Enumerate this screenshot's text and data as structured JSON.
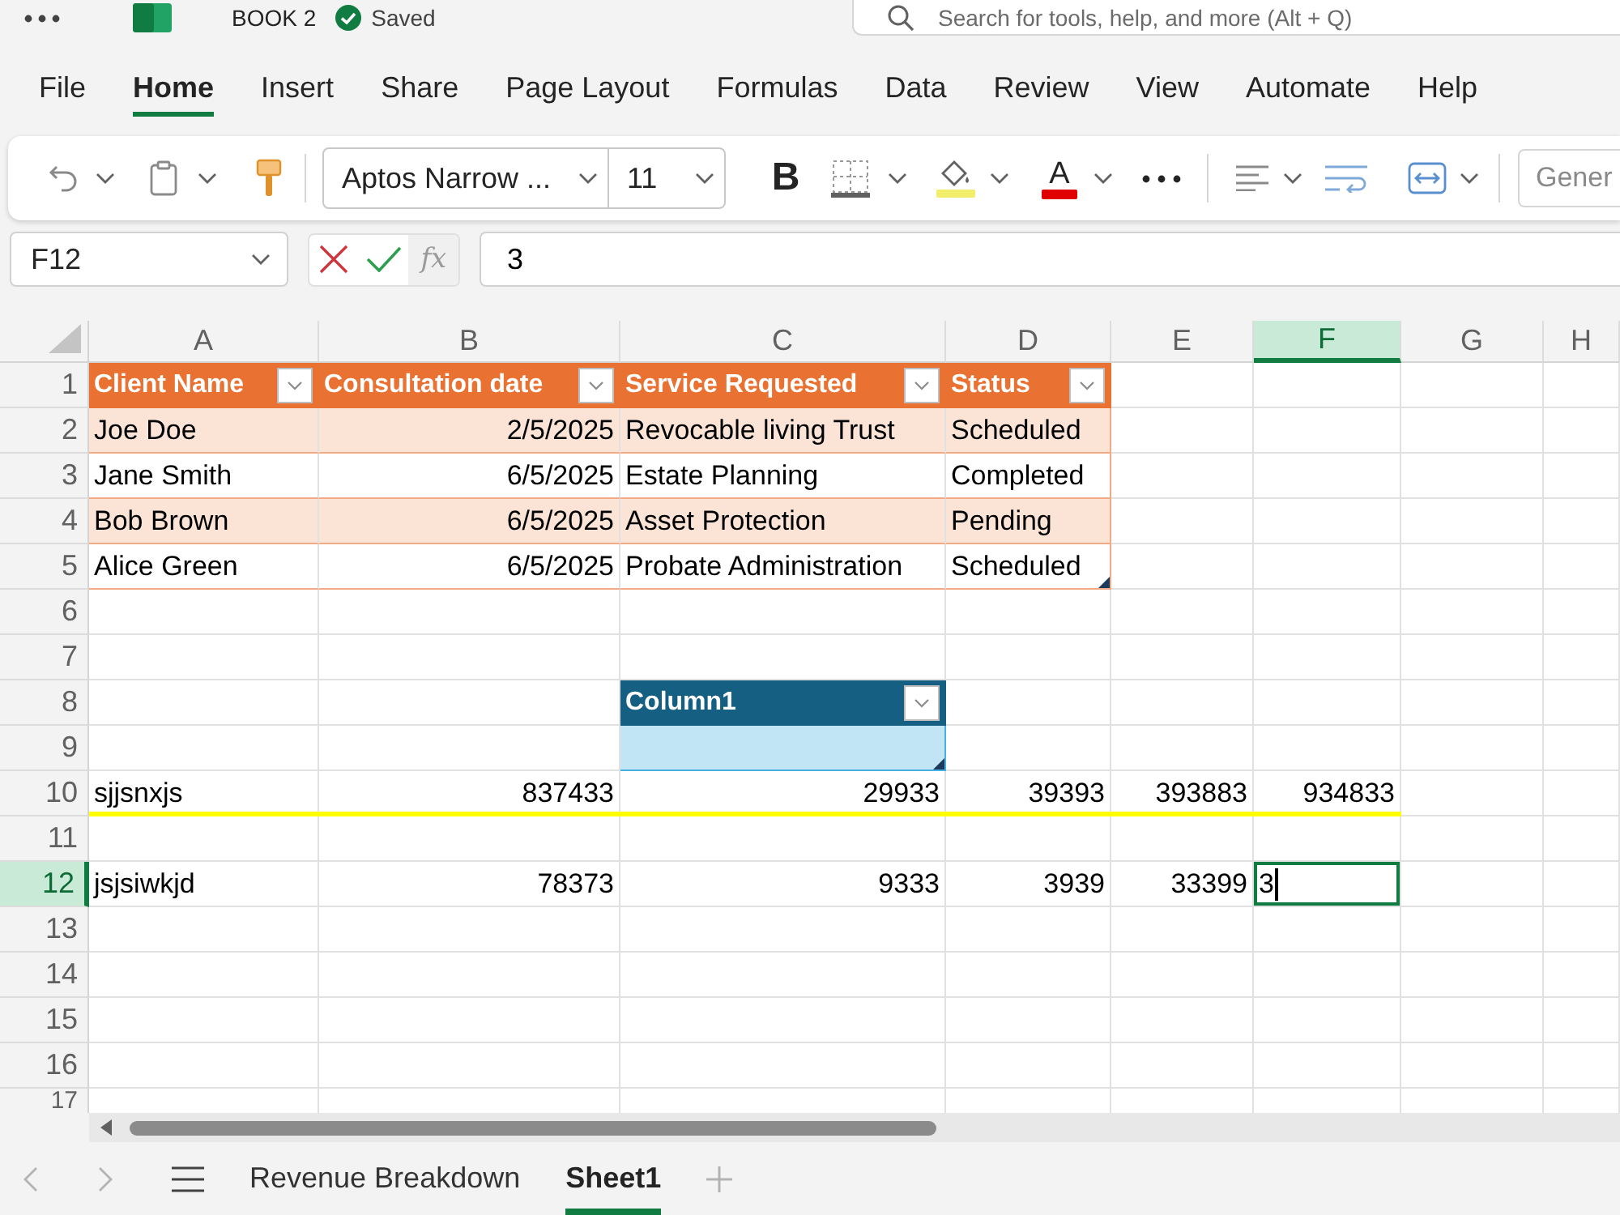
{
  "title_bar": {
    "document": "BOOK 2",
    "save_status": "Saved",
    "search": {
      "placeholder": "Search for tools, help, and more (Alt + Q)"
    }
  },
  "menu": [
    {
      "label": "File",
      "selected": false
    },
    {
      "label": "Home",
      "selected": true
    },
    {
      "label": "Insert",
      "selected": false
    },
    {
      "label": "Share",
      "selected": false
    },
    {
      "label": "Page Layout",
      "selected": false
    },
    {
      "label": "Formulas",
      "selected": false
    },
    {
      "label": "Data",
      "selected": false
    },
    {
      "label": "Review",
      "selected": false
    },
    {
      "label": "View",
      "selected": false
    },
    {
      "label": "Automate",
      "selected": false
    },
    {
      "label": "Help",
      "selected": false
    }
  ],
  "toolbar": {
    "font": "Aptos Narrow ...",
    "font_size": "11",
    "bold": "B",
    "font_color": "A",
    "number_format": {
      "value": "Gener",
      "disabled": true
    }
  },
  "formula_bar": {
    "name_box": "F12",
    "function": "fx",
    "value": "3"
  },
  "sheet": {
    "columns": [
      {
        "label": "A",
        "selected": false
      },
      {
        "label": "B",
        "selected": false
      },
      {
        "label": "C",
        "selected": false
      },
      {
        "label": "D",
        "selected": false
      },
      {
        "label": "E",
        "selected": false
      },
      {
        "label": "F",
        "selected": true
      },
      {
        "label": "G",
        "selected": false
      },
      {
        "label": "H",
        "selected": false
      }
    ],
    "rows": [
      {
        "label": "1",
        "selected": false,
        "underline": false,
        "cells": [
          {
            "kind": "head",
            "text": "Client Name",
            "color": "#e97132"
          },
          {
            "kind": "head",
            "text": "Consultation date",
            "color": "#e97132"
          },
          {
            "kind": "head",
            "text": "Service Requested",
            "color": "#e97132"
          },
          {
            "kind": "head",
            "text": "Status",
            "color": "#e97132"
          }
        ]
      },
      {
        "label": "2",
        "selected": false,
        "underline": false,
        "cells": [
          {
            "kind": "text",
            "text": "Joe Doe",
            "shaded": true
          },
          {
            "kind": "number",
            "text": "2/5/2025",
            "shaded": true
          },
          {
            "kind": "text",
            "text": "Revocable living Trust",
            "shaded": true
          },
          {
            "kind": "text",
            "text": "Scheduled",
            "shaded": true
          }
        ]
      },
      {
        "label": "3",
        "selected": false,
        "underline": false,
        "cells": [
          {
            "kind": "text",
            "text": "Jane Smith",
            "shaded": false
          },
          {
            "kind": "number",
            "text": "6/5/2025",
            "shaded": false
          },
          {
            "kind": "text",
            "text": "Estate Planning",
            "shaded": false
          },
          {
            "kind": "text",
            "text": "Completed",
            "shaded": false
          }
        ]
      },
      {
        "label": "4",
        "selected": false,
        "underline": false,
        "cells": [
          {
            "kind": "text",
            "text": "Bob Brown",
            "shaded": true
          },
          {
            "kind": "number",
            "text": "6/5/2025",
            "shaded": true
          },
          {
            "kind": "text",
            "text": "Asset Protection",
            "shaded": true
          },
          {
            "kind": "text",
            "text": "Pending",
            "shaded": true
          }
        ]
      },
      {
        "label": "5",
        "selected": false,
        "underline": false,
        "cells": [
          {
            "kind": "text",
            "text": "Alice Green",
            "shaded": false
          },
          {
            "kind": "number",
            "text": "6/5/2025",
            "shaded": false
          },
          {
            "kind": "text",
            "text": "Probate Administration",
            "shaded": false
          },
          {
            "kind": "text",
            "text": "Scheduled",
            "shaded": false
          }
        ]
      },
      {
        "label": "6",
        "selected": false,
        "underline": false
      },
      {
        "label": "7",
        "selected": false,
        "underline": false
      },
      {
        "label": "8",
        "selected": false,
        "underline": false,
        "cells": [
          {
            "kind": "blank"
          },
          {
            "kind": "blank"
          },
          {
            "kind": "head",
            "text": "Column1",
            "color": "#156082"
          }
        ]
      },
      {
        "label": "9",
        "selected": false,
        "underline": false,
        "cells": [
          {
            "kind": "blank"
          },
          {
            "kind": "blank"
          },
          {
            "kind": "blank",
            "shaded": true
          }
        ]
      },
      {
        "label": "10",
        "selected": false,
        "underline": true,
        "cells": [
          {
            "kind": "text",
            "text": "sjjsnxjs"
          },
          {
            "kind": "number",
            "text": "837433"
          },
          {
            "kind": "number",
            "text": "29933"
          },
          {
            "kind": "number",
            "text": "39393"
          },
          {
            "kind": "number",
            "text": "393883"
          },
          {
            "kind": "number",
            "text": "934833"
          }
        ]
      },
      {
        "label": "11",
        "selected": false,
        "underline": false
      },
      {
        "label": "12",
        "selected": true,
        "underline": false,
        "cells": [
          {
            "kind": "text",
            "text": "jsjsiwkjd"
          },
          {
            "kind": "number",
            "text": "78373"
          },
          {
            "kind": "number",
            "text": "9333"
          },
          {
            "kind": "number",
            "text": "3939"
          },
          {
            "kind": "number",
            "text": "33399"
          },
          {
            "kind": "editing",
            "text": "3"
          }
        ]
      },
      {
        "label": "13",
        "selected": false,
        "underline": false
      },
      {
        "label": "14",
        "selected": false,
        "underline": false
      },
      {
        "label": "15",
        "selected": false,
        "underline": false
      },
      {
        "label": "16",
        "selected": false,
        "underline": false
      },
      {
        "label": "17",
        "selected": false,
        "underline": false
      }
    ]
  },
  "sheet_tabs": [
    {
      "label": "Revenue Breakdown",
      "selected": false
    },
    {
      "label": "Sheet1",
      "selected": true
    }
  ]
}
